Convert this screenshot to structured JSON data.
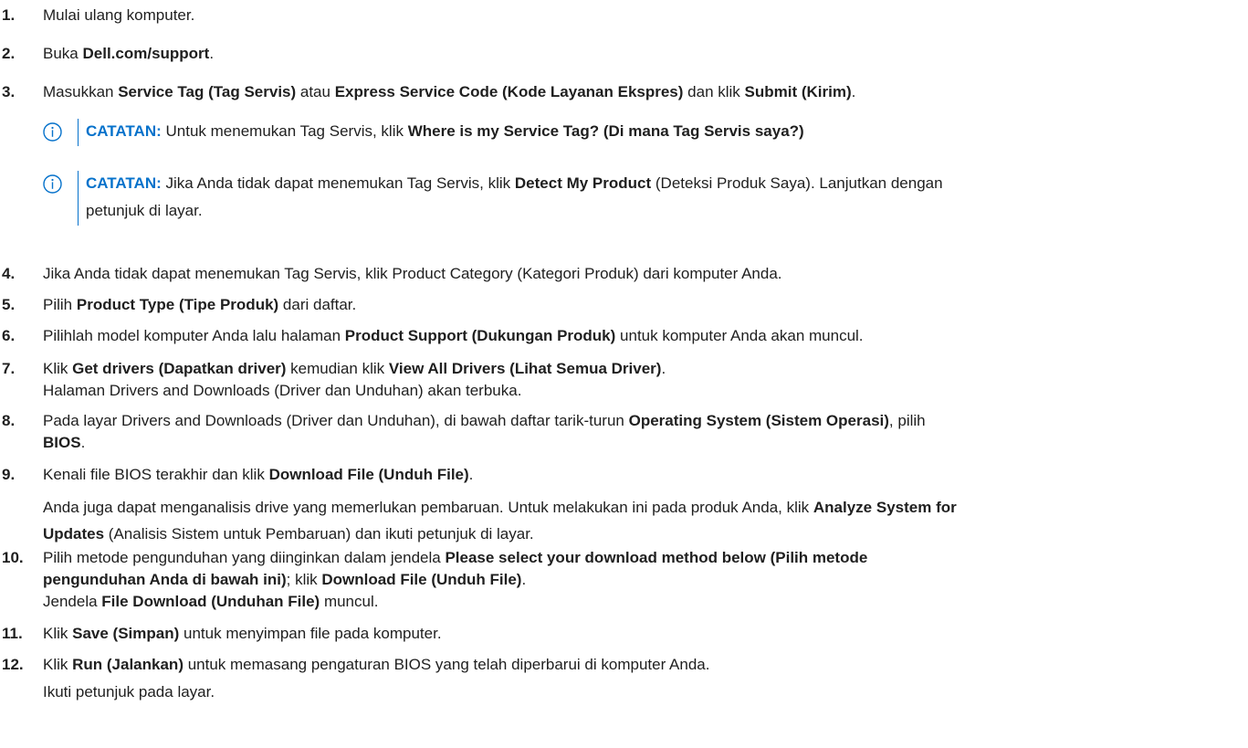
{
  "steps": [
    {
      "num": "1.",
      "parts": [
        {
          "t": "Mulai ulang komputer."
        }
      ]
    },
    {
      "num": "2.",
      "parts": [
        {
          "t": "Buka "
        },
        {
          "t": "Dell.com/support",
          "b": true
        },
        {
          "t": "."
        }
      ]
    },
    {
      "num": "3.",
      "parts": [
        {
          "t": "Masukkan "
        },
        {
          "t": "Service Tag (Tag Servis)",
          "b": true
        },
        {
          "t": " atau "
        },
        {
          "t": "Express Service Code (Kode Layanan Ekspres)",
          "b": true
        },
        {
          "t": " dan klik "
        },
        {
          "t": "Submit (Kirim)",
          "b": true
        },
        {
          "t": "."
        }
      ]
    },
    {
      "num": "4.",
      "parts": [
        {
          "t": "Jika Anda tidak dapat menemukan Tag Servis, klik Product Category (Kategori Produk) dari komputer Anda."
        }
      ]
    },
    {
      "num": "5.",
      "parts": [
        {
          "t": "Pilih "
        },
        {
          "t": "Product Type (Tipe Produk)",
          "b": true
        },
        {
          "t": " dari daftar."
        }
      ]
    },
    {
      "num": "6.",
      "parts": [
        {
          "t": "Pilihlah model komputer Anda lalu halaman "
        },
        {
          "t": "Product Support (Dukungan Produk)",
          "b": true
        },
        {
          "t": " untuk komputer Anda akan muncul."
        }
      ]
    },
    {
      "num": "7.",
      "parts": [
        {
          "t": "Klik "
        },
        {
          "t": "Get drivers (Dapatkan driver)",
          "b": true
        },
        {
          "t": " kemudian klik "
        },
        {
          "t": "View All Drivers (Lihat Semua Driver)",
          "b": true
        },
        {
          "t": "."
        },
        {
          "br": true
        },
        {
          "t": "Halaman Drivers and Downloads (Driver dan Unduhan) akan terbuka."
        }
      ]
    },
    {
      "num": "8.",
      "parts": [
        {
          "t": "Pada layar Drivers and Downloads (Driver dan Unduhan), di bawah daftar tarik-turun "
        },
        {
          "t": "Operating System (Sistem Operasi)",
          "b": true
        },
        {
          "t": ", pilih "
        },
        {
          "br": true
        },
        {
          "t": "BIOS",
          "b": true
        },
        {
          "t": "."
        }
      ]
    },
    {
      "num": "9.",
      "parts": [
        {
          "t": "Kenali file BIOS terakhir dan klik "
        },
        {
          "t": "Download File (Unduh File)",
          "b": true
        },
        {
          "t": "."
        }
      ]
    },
    {
      "num": "",
      "parts": [
        {
          "t": "Anda juga dapat menganalisis drive yang memerlukan pembaruan. Untuk melakukan ini pada produk Anda, klik "
        },
        {
          "t": "Analyze System for",
          "b": true
        },
        {
          "br": true
        },
        {
          "t": "Updates",
          "b": true
        },
        {
          "t": " (Analisis Sistem untuk Pembaruan) dan ikuti petunjuk di layar."
        }
      ]
    },
    {
      "num": "10.",
      "parts": [
        {
          "t": "Pilih metode pengunduhan yang diinginkan dalam jendela "
        },
        {
          "t": "Please select your download method below (Pilih metode",
          "b": true
        },
        {
          "br": true
        },
        {
          "t": "pengunduhan Anda di bawah ini)",
          "b": true
        },
        {
          "t": "; klik "
        },
        {
          "t": "Download File (Unduh File)",
          "b": true
        },
        {
          "t": "."
        },
        {
          "br": true
        },
        {
          "t": "Jendela "
        },
        {
          "t": "File Download (Unduhan File)",
          "b": true
        },
        {
          "t": " muncul."
        }
      ]
    },
    {
      "num": "11.",
      "parts": [
        {
          "t": "Klik "
        },
        {
          "t": "Save (Simpan)",
          "b": true
        },
        {
          "t": " untuk menyimpan file pada komputer."
        }
      ]
    },
    {
      "num": "12.",
      "parts": [
        {
          "t": "Klik "
        },
        {
          "t": "Run (Jalankan)",
          "b": true
        },
        {
          "t": " untuk memasang pengaturan BIOS yang telah diperbarui di komputer Anda."
        }
      ]
    },
    {
      "num": "",
      "parts": [
        {
          "t": "Ikuti petunjuk pada layar."
        }
      ]
    }
  ],
  "notes": [
    {
      "label": "CATATAN:",
      "parts": [
        {
          "t": " Untuk menemukan Tag Servis, klik "
        },
        {
          "t": "Where is my Service Tag? (Di mana Tag Servis saya?)",
          "b": true
        }
      ]
    },
    {
      "label": "CATATAN:",
      "parts": [
        {
          "t": " Jika Anda tidak dapat menemukan Tag Servis, klik "
        },
        {
          "t": "Detect My Product",
          "b": true
        },
        {
          "t": " (Deteksi Produk Saya). Lanjutkan dengan "
        },
        {
          "br": true
        },
        {
          "t": "petunjuk di layar."
        }
      ]
    }
  ],
  "colors": {
    "accent": "#0672cb",
    "text": "#1f1f1f"
  },
  "icons": {
    "note": "info-icon"
  }
}
